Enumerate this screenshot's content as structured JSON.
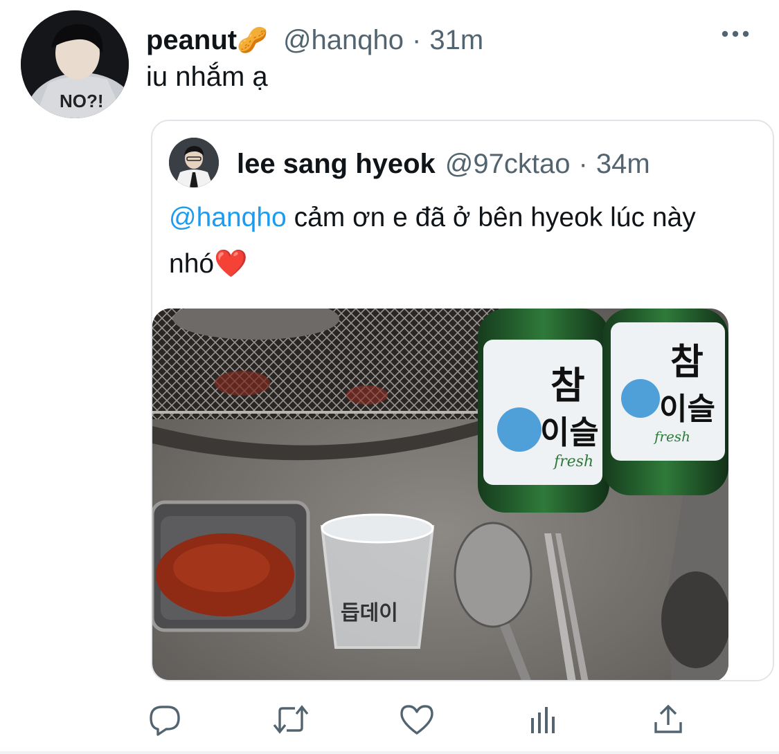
{
  "tweet": {
    "display_name": "peanut",
    "name_emoji": "🥜",
    "handle": "@hanqho",
    "separator": "·",
    "time": "31m",
    "text": "iu nhắm ạ",
    "avatar_text": "NO?!"
  },
  "quoted": {
    "display_name": "lee sang hyeok",
    "handle": "@97cktao",
    "separator": "·",
    "time": "34m",
    "mention": "@hanqho",
    "text": " cảm ơn e đã ở bên hyeok lúc này nhó",
    "heart": "❤️",
    "photo": {
      "bottle_label_big_1": "참",
      "bottle_label_big_2": "이슬",
      "bottle_label_small": "fresh",
      "glass_text": "듭데이"
    }
  },
  "actions": [
    "reply-icon",
    "retweet-icon",
    "like-icon",
    "analytics-icon",
    "share-icon"
  ],
  "colors": {
    "text": "#0f1419",
    "secondary": "#536471",
    "link": "#1d9bf0",
    "border": "#e1e5e9"
  }
}
